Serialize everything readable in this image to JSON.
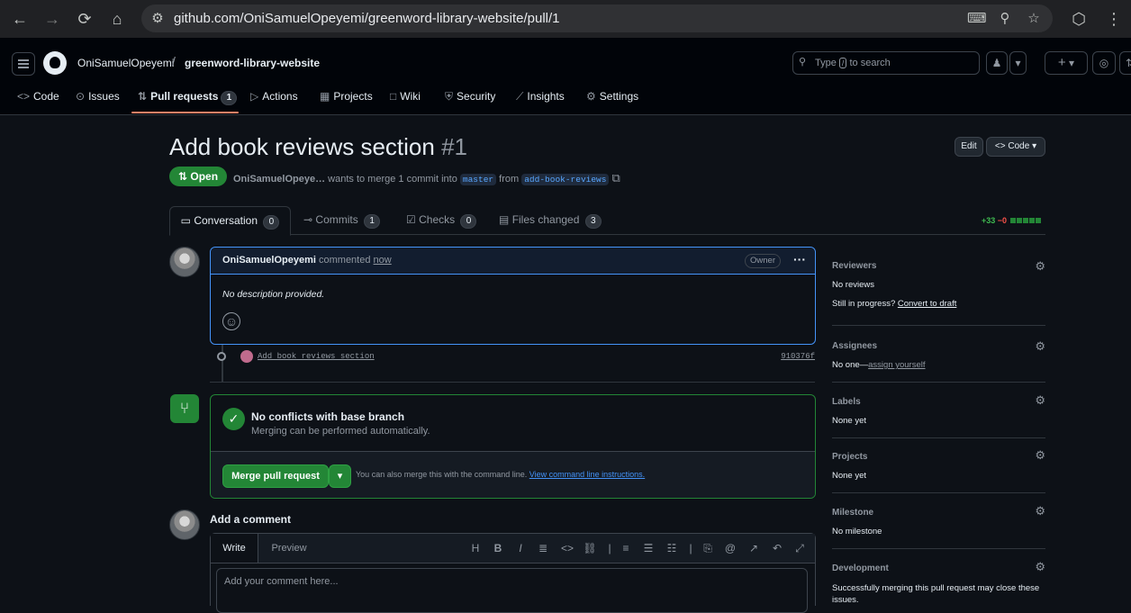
{
  "browser": {
    "url": "github.com/OniSamuelOpeyemi/greenword-library-website/pull/1",
    "back_icon": "←",
    "forward_icon": "→",
    "reload_icon": "⟳",
    "home_icon": "⌂",
    "site_info_icon": "⚙",
    "install_icon": "⌨",
    "zoom_icon": "⚲",
    "bookmark_icon": "☆",
    "extensions_icon": "⬡",
    "menu_icon": "⋮"
  },
  "header": {
    "owner": "OniSamuelOpeyemi",
    "separator": "/",
    "repo": "greenword-library-website",
    "search_prefix": "Type",
    "search_key": "/",
    "search_suffix": "to search",
    "copilot_icon": "♟",
    "dropdown_icon": "▾",
    "plus_icon": "+",
    "issues_icon": "◎",
    "pr_icon": "⇅"
  },
  "repo_tabs": [
    {
      "icon": "<>",
      "label": "Code"
    },
    {
      "icon": "⊙",
      "label": "Issues"
    },
    {
      "icon": "⇅",
      "label": "Pull requests",
      "count": "1"
    },
    {
      "icon": "▷",
      "label": "Actions"
    },
    {
      "icon": "▦",
      "label": "Projects"
    },
    {
      "icon": "□",
      "label": "Wiki"
    },
    {
      "icon": "⛨",
      "label": "Security"
    },
    {
      "icon": "⟋",
      "label": "Insights"
    },
    {
      "icon": "⚙",
      "label": "Settings"
    }
  ],
  "pr": {
    "title": "Add book reviews section",
    "number": "#1",
    "edit_label": "Edit",
    "code_label": "Code",
    "state": "Open",
    "author": "OniSamuelOpeye…",
    "merge_text_1": "wants to merge 1 commit into",
    "base_branch": "master",
    "merge_text_2": "from",
    "head_branch": "add-book-reviews",
    "copy_icon": "⧉"
  },
  "pr_tabs": [
    {
      "icon": "▭",
      "label": "Conversation",
      "count": "0"
    },
    {
      "icon": "⊸",
      "label": "Commits",
      "count": "1"
    },
    {
      "icon": "☑",
      "label": "Checks",
      "count": "0"
    },
    {
      "icon": "▤",
      "label": "Files changed",
      "count": "3"
    }
  ],
  "diffstat": {
    "added": "+33",
    "removed": "−0"
  },
  "comment": {
    "author": "OniSamuelOpeyemi",
    "action": "commented",
    "time": "now",
    "badge": "Owner",
    "menu_icon": "···",
    "body": "No description provided.",
    "reaction_icon": "☺"
  },
  "commit": {
    "message": "Add book reviews section",
    "sha": "910376f"
  },
  "merge": {
    "icon": "⑂",
    "check_icon": "✓",
    "title": "No conflicts with base branch",
    "subtitle": "Merging can be performed automatically.",
    "button": "Merge pull request",
    "dropdown_icon": "▾",
    "hint": "You can also merge this with the command line.",
    "hint_link": "View command line instructions."
  },
  "composer": {
    "title": "Add a comment",
    "tabs": [
      "Write",
      "Preview"
    ],
    "placeholder": "Add your comment here...",
    "tools": [
      "H",
      "B",
      "I",
      "≣",
      "<>",
      "⛓",
      "|",
      "≡",
      "☰",
      "☷",
      "|",
      "⎘",
      "@",
      "↗",
      "↶",
      "⤢"
    ]
  },
  "sidebar": {
    "reviewers_title": "Reviewers",
    "reviewers_value": "No reviews",
    "progress_text": "Still in progress?",
    "progress_link": "Convert to draft",
    "assignees_title": "Assignees",
    "assignees_value": "No one—",
    "assignees_link": "assign yourself",
    "labels_title": "Labels",
    "labels_value": "None yet",
    "projects_title": "Projects",
    "projects_value": "None yet",
    "milestone_title": "Milestone",
    "milestone_value": "No milestone",
    "development_title": "Development",
    "development_value": "Successfully merging this pull request may close these issues.",
    "gear_icon": "⚙"
  }
}
